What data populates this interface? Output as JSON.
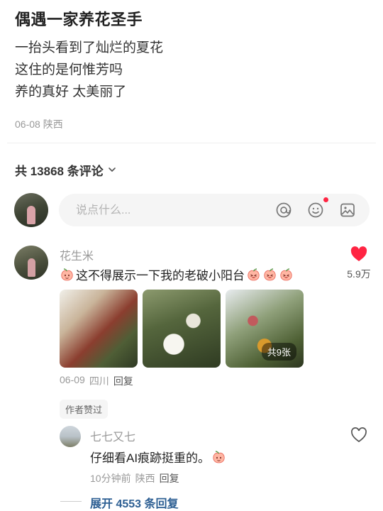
{
  "post": {
    "title": "偶遇一家养花圣手",
    "lines": [
      "一抬头看到了灿烂的夏花",
      "这住的是何惟芳吗",
      "养的真好 太美丽了"
    ],
    "date": "06-08",
    "location": "陕西"
  },
  "comments_header": {
    "label": "共 13868 条评论",
    "chevron_icon": "chevron-down-icon"
  },
  "comment_input": {
    "placeholder": "说点什么...",
    "icons": [
      "at-icon",
      "emoji-icon",
      "image-icon"
    ],
    "emoji_badge_color": "#ff2442"
  },
  "comments": [
    {
      "username": "花生米",
      "text": "这不得展示一下我的老破小阳台",
      "like_count": "5.9万",
      "liked": true,
      "photo_badge": "共9张",
      "date": "06-09",
      "location": "四川",
      "reply_label": "回复",
      "author_liked_label": "作者赞过"
    }
  ],
  "replies": [
    {
      "username": "七七又七",
      "text": "仔细看AI痕跡挺重的。",
      "time": "10分钟前",
      "location": "陕西",
      "reply_label": "回复",
      "liked": false
    }
  ],
  "expand": {
    "label": "展开 4553 条回复"
  },
  "colors": {
    "like_red": "#ff2442",
    "link_blue": "#2d5f93"
  }
}
